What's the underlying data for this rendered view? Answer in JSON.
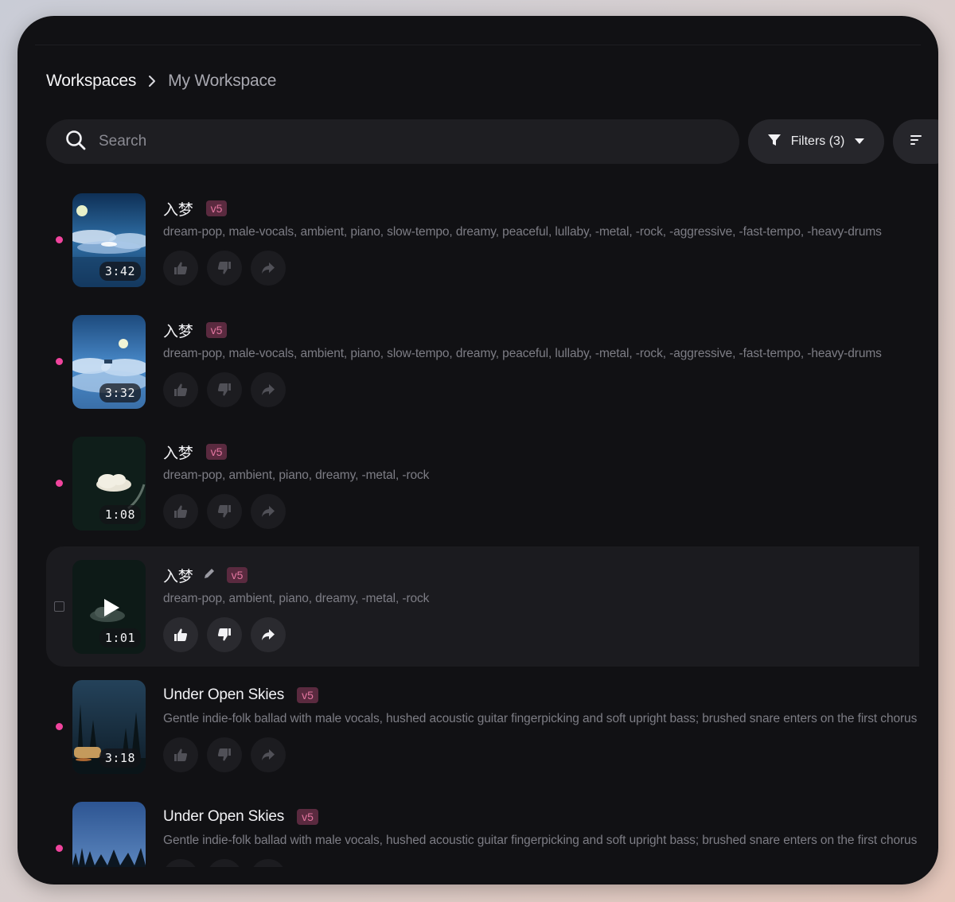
{
  "breadcrumb": {
    "root": "Workspaces",
    "current": "My Workspace"
  },
  "search": {
    "placeholder": "Search",
    "value": ""
  },
  "filters": {
    "label": "Filters (3)"
  },
  "songs": [
    {
      "title": "入梦",
      "version": "v5",
      "tags": "dream-pop, male-vocals, ambient, piano, slow-tempo, dreamy, peaceful, lullaby, -metal, -rock, -aggressive, -fast-tempo, -heavy-drums",
      "duration": "3:42",
      "art": "moon-clouds"
    },
    {
      "title": "入梦",
      "version": "v5",
      "tags": "dream-pop, male-vocals, ambient, piano, slow-tempo, dreamy, peaceful, lullaby, -metal, -rock, -aggressive, -fast-tempo, -heavy-drums",
      "duration": "3:32",
      "art": "moon-clouds-2"
    },
    {
      "title": "入梦",
      "version": "v5",
      "tags": "dream-pop, ambient, piano, dreamy, -metal, -rock",
      "duration": "1:08",
      "art": "dark-cloud"
    },
    {
      "title": "入梦",
      "version": "v5",
      "tags": "dream-pop, ambient, piano, dreamy, -metal, -rock",
      "duration": "1:01",
      "art": "dark-cloud-play",
      "active": true
    },
    {
      "title": "Under Open Skies",
      "version": "v5",
      "tags": "Gentle indie-folk ballad with male vocals, hushed acoustic guitar fingerpicking and soft upright bass; brushed snare enters on the first chorus",
      "duration": "3:18",
      "art": "forest-night-car"
    },
    {
      "title": "Under Open Skies",
      "version": "v5",
      "tags": "Gentle indie-folk ballad with male vocals, hushed acoustic guitar fingerpicking and soft upright bass; brushed snare enters on the first chorus",
      "duration": "",
      "art": "forest-night"
    }
  ],
  "colors": {
    "accent_dot": "#f0449d",
    "badge_bg": "#5a2a3f",
    "badge_text": "#e2759f",
    "window_bg": "#111114"
  },
  "icons": {
    "search": "search-icon",
    "filter": "filter-icon",
    "dropdown": "chevron-down-icon",
    "like": "thumbs-up-icon",
    "dislike": "thumbs-down-icon",
    "share": "share-icon",
    "edit": "pencil-icon",
    "play": "play-icon",
    "sort": "sort-icon"
  }
}
